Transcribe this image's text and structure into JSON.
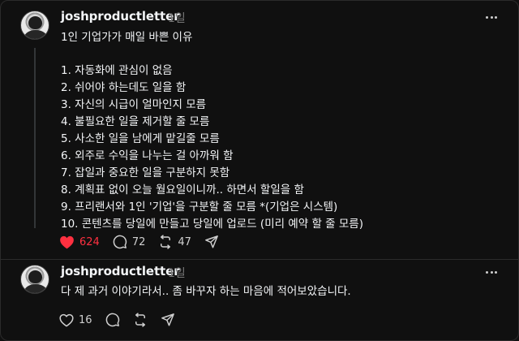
{
  "colors": {
    "background": "#101010",
    "text": "#f3f5f7",
    "muted": "#777777",
    "liked": "#ff3040",
    "divider": "#2b2b2b"
  },
  "posts": [
    {
      "username": "joshproductletter",
      "timestamp": "1일",
      "title": "1인 기업가가 매일 바쁜 이유",
      "items": [
        "1. 자동화에 관심이 없음",
        "2. 쉬어야 하는데도 일을 함",
        "3. 자신의 시급이 얼마인지 모름",
        "4. 불필요한 일을 제거할 줄 모름",
        "5. 사소한 일을 남에게 맡길줄 모름",
        "6. 외주로 수익을 나누는 걸 아까워 함",
        "7. 잡일과 중요한 일을 구분하지 못함",
        "8. 계획표 없이 오늘 월요일이니까.. 하면서 할일을 함",
        "9. 프리랜서와 1인 '기업'을 구분할 줄 모름 *(기업은 시스템)",
        "10. 콘텐츠를 당일에 만들고 당일에 업로드 (미리 예약 할 줄 모름)"
      ],
      "likes": "624",
      "liked": true,
      "replies": "72",
      "reposts": "47",
      "icons": [
        "heart-icon",
        "comment-icon",
        "repost-icon",
        "share-icon",
        "more-icon"
      ]
    },
    {
      "username": "joshproductletter",
      "timestamp": "1일",
      "text": "다 제 과거 이야기라서.. 좀 바꾸자 하는 마음에 적어보았습니다.",
      "likes": "16",
      "liked": false,
      "icons": [
        "heart-icon",
        "comment-icon",
        "repost-icon",
        "share-icon",
        "more-icon"
      ]
    }
  ]
}
